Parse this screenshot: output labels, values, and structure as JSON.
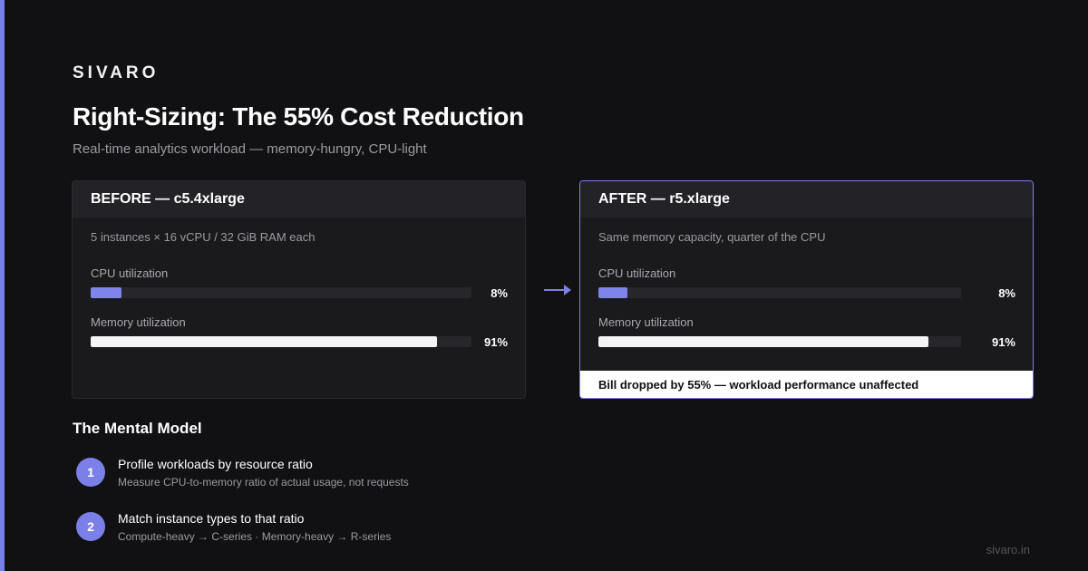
{
  "brand": "SIVARO",
  "title": "Right-Sizing: The 55% Cost Reduction",
  "subtitle": "Real-time analytics workload — memory-hungry, CPU-light",
  "before": {
    "header": "BEFORE — c5.4xlarge",
    "description": "5 instances × 16 vCPU / 32 GiB RAM each",
    "cpu_label": "CPU utilization",
    "cpu_value": "8%",
    "cpu_fraction": 0.08,
    "mem_label": "Memory utilization",
    "mem_value": "91%",
    "mem_fraction": 0.91
  },
  "after": {
    "header": "AFTER — r5.xlarge",
    "description": "Same memory capacity, quarter of the CPU",
    "cpu_label": "CPU utilization",
    "cpu_value": "8%",
    "cpu_fraction": 0.08,
    "mem_label": "Memory utilization",
    "mem_value": "91%",
    "mem_fraction": 0.91,
    "result": "Bill dropped by 55% — workload performance unaffected"
  },
  "arrow_icon": "arrow-right-icon",
  "mental_model": {
    "title": "The Mental Model",
    "steps": [
      {
        "number": "1",
        "title": "Profile workloads by resource ratio",
        "subtitle": "Measure CPU-to-memory ratio of actual usage, not requests"
      },
      {
        "number": "2",
        "title": "Match instance types to that ratio",
        "subtitle": "Compute-heavy → C-series · Memory-heavy → R-series"
      }
    ]
  },
  "footer_url": "sivaro.in",
  "colors": {
    "accent": "#7b80e8",
    "background": "#111113",
    "card": "#1a1a1d",
    "memory_bar": "#f4f4f6"
  }
}
